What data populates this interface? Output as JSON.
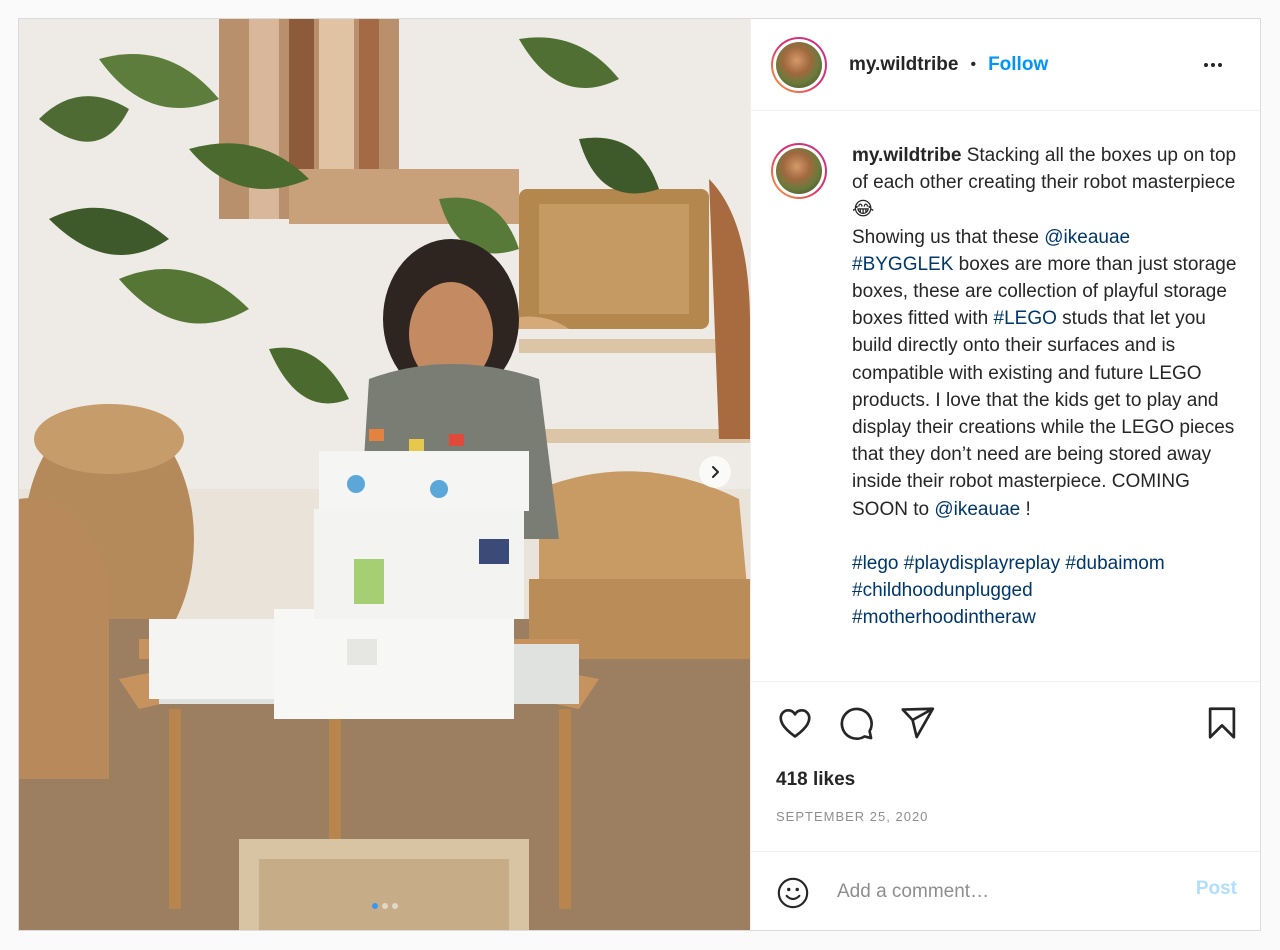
{
  "post": {
    "username": "my.wildtribe",
    "separator": "•",
    "follow_label": "Follow",
    "caption_parts": [
      {
        "text": "Stacking all the boxes up on top of each other creating their robot masterpiece 😂\nShowing us that these ",
        "type": "text"
      },
      {
        "text": "@ikeauae",
        "type": "link"
      },
      {
        "text": "\n",
        "type": "text"
      },
      {
        "text": "#BYGGLEK",
        "type": "link"
      },
      {
        "text": " boxes are more than just storage boxes, these are collection of playful storage boxes fitted with ",
        "type": "text"
      },
      {
        "text": "#LEGO",
        "type": "link"
      },
      {
        "text": " studs that let you build directly onto their surfaces and is compatible with existing and future LEGO products. I love that the kids get to play and display their creations while the LEGO pieces that they don’t need are being stored away inside their robot masterpiece. COMING SOON to ",
        "type": "text"
      },
      {
        "text": "@ikeauae",
        "type": "link"
      },
      {
        "text": " !\n\n",
        "type": "text"
      },
      {
        "text": "#lego",
        "type": "link"
      },
      {
        "text": " ",
        "type": "text"
      },
      {
        "text": "#playdisplayreplay",
        "type": "link"
      },
      {
        "text": " ",
        "type": "text"
      },
      {
        "text": "#dubaimom",
        "type": "link"
      },
      {
        "text": "\n",
        "type": "text"
      },
      {
        "text": "#childhoodunplugged",
        "type": "link"
      },
      {
        "text": "\n",
        "type": "text"
      },
      {
        "text": "#motherhoodintheraw",
        "type": "link"
      }
    ],
    "likes": "418 likes",
    "date": "SEPTEMBER 25, 2020",
    "comment_placeholder": "Add a comment…",
    "post_label": "Post",
    "carousel": {
      "total": 3,
      "active": 0
    },
    "icons": {
      "more": "more-options-icon",
      "like": "heart-icon",
      "comment": "comment-icon",
      "share": "share-icon",
      "save": "bookmark-icon",
      "emoji": "emoji-icon",
      "next": "chevron-right-icon"
    },
    "colors": {
      "follow": "#0095f6",
      "link": "#00376b",
      "post_disabled": "#b2dffc",
      "muted": "#8e8e8e"
    }
  }
}
